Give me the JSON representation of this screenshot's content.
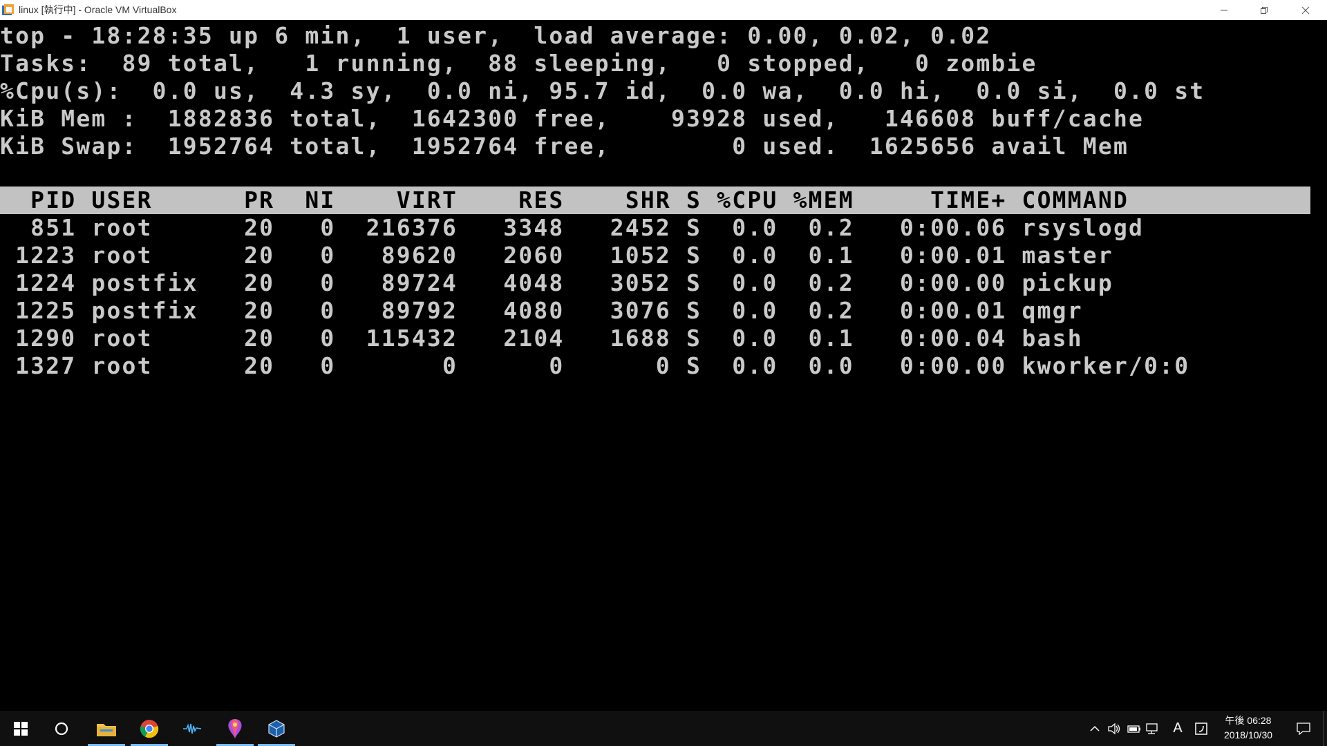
{
  "window": {
    "title": "linux [執行中] - Oracle VM VirtualBox"
  },
  "terminal": {
    "summary": [
      "top - 18:28:35 up 6 min,  1 user,  load average: 0.00, 0.02, 0.02",
      "Tasks:  89 total,   1 running,  88 sleeping,   0 stopped,   0 zombie",
      "%Cpu(s):  0.0 us,  4.3 sy,  0.0 ni, 95.7 id,  0.0 wa,  0.0 hi,  0.0 si,  0.0 st",
      "KiB Mem :  1882836 total,  1642300 free,    93928 used,   146608 buff/cache",
      "KiB Swap:  1952764 total,  1952764 free,        0 used.  1625656 avail Mem"
    ],
    "process_header": "  PID USER      PR  NI    VIRT    RES    SHR S %CPU %MEM     TIME+ COMMAND",
    "processes": [
      "  851 root      20   0  216376   3348   2452 S  0.0  0.2   0:00.06 rsyslogd",
      " 1223 root      20   0   89620   2060   1052 S  0.0  0.1   0:00.01 master",
      " 1224 postfix   20   0   89724   4048   3052 S  0.0  0.2   0:00.00 pickup",
      " 1225 postfix   20   0   89792   4080   3076 S  0.0  0.2   0:00.01 qmgr",
      " 1290 root      20   0  115432   2104   1688 S  0.0  0.1   0:00.04 bash",
      " 1327 root      20   0       0      0      0 S  0.0  0.0   0:00.00 kworker/0:0"
    ]
  },
  "taskbar": {
    "apps": [
      {
        "icon": "file-explorer-icon",
        "active": true
      },
      {
        "icon": "chrome-icon",
        "active": true
      },
      {
        "icon": "audio-app-icon",
        "active": false
      },
      {
        "icon": "paint-app-icon",
        "active": true
      },
      {
        "icon": "virtualbox-icon",
        "active": true
      }
    ],
    "clock": {
      "time": "午後 06:28",
      "date": "2018/10/30"
    },
    "ime": "A"
  },
  "colors": {
    "terminal_bg": "#000000",
    "terminal_fg": "#c9c9c9",
    "header_bar": "#c2c2c2",
    "taskbar_bg": "#101010",
    "active_indicator": "#76b9ed"
  }
}
